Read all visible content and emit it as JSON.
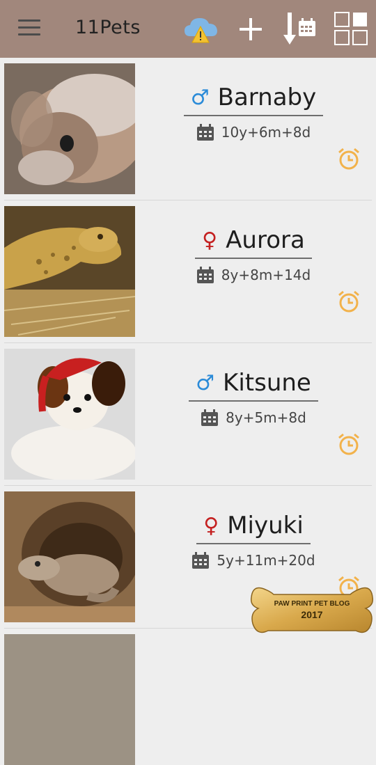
{
  "app": {
    "title": "11Pets"
  },
  "toolbar": {
    "menu_icon": "hamburger-menu-icon",
    "sync_icon": "cloud-warning-icon",
    "add_icon": "plus-icon",
    "sort_icon": "sort-down-calendar-icon",
    "view_icon": "grid-view-icon"
  },
  "pets": [
    {
      "name": "Barnaby",
      "gender": "♂",
      "gender_color": "#2b8bd8",
      "age": "10y+6m+8d"
    },
    {
      "name": "Aurora",
      "gender": "♀",
      "gender_color": "#c42020",
      "age": "8y+8m+14d"
    },
    {
      "name": "Kitsune",
      "gender": "♂",
      "gender_color": "#2b8bd8",
      "age": "8y+5m+8d"
    },
    {
      "name": "Miyuki",
      "gender": "♀",
      "gender_color": "#c42020",
      "age": "5y+11m+20d"
    }
  ],
  "badge": {
    "line1": "PAW PRINT PET BLOG",
    "line2": "2017"
  },
  "colors": {
    "toolbar": "#a1877c",
    "alarm": "#f2b24b",
    "background": "#eeeeee"
  }
}
